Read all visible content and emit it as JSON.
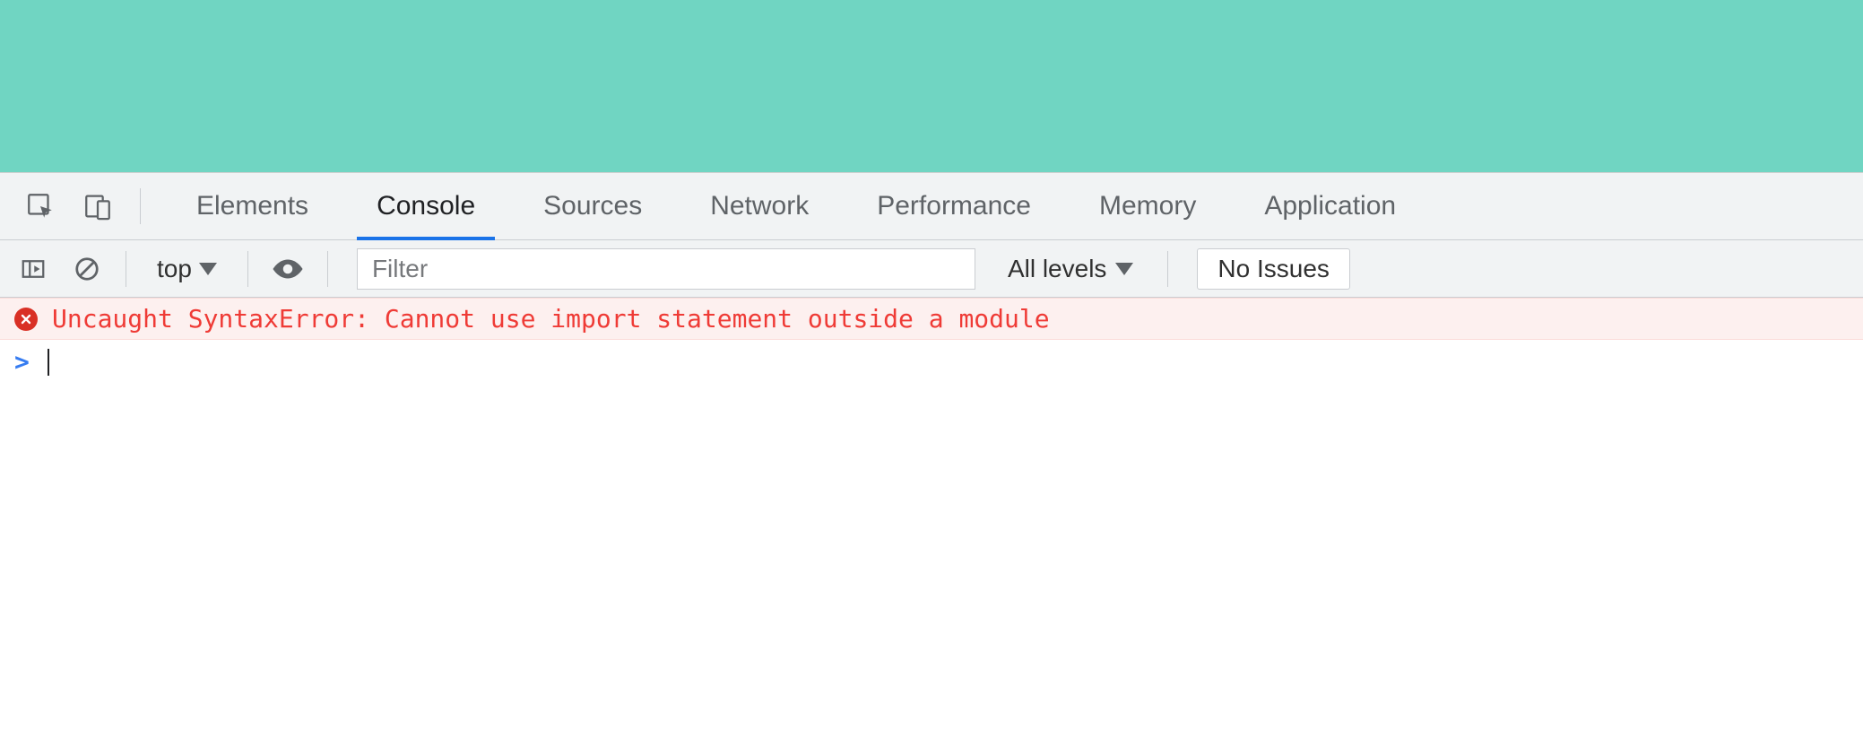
{
  "tabs": {
    "elements": "Elements",
    "console": "Console",
    "sources": "Sources",
    "network": "Network",
    "performance": "Performance",
    "memory": "Memory",
    "application": "Application"
  },
  "toolbar": {
    "context": "top",
    "filter_placeholder": "Filter",
    "levels": "All levels",
    "issues": "No Issues"
  },
  "console": {
    "error_message": "Uncaught SyntaxError: Cannot use import statement outside a module",
    "prompt": ">"
  }
}
